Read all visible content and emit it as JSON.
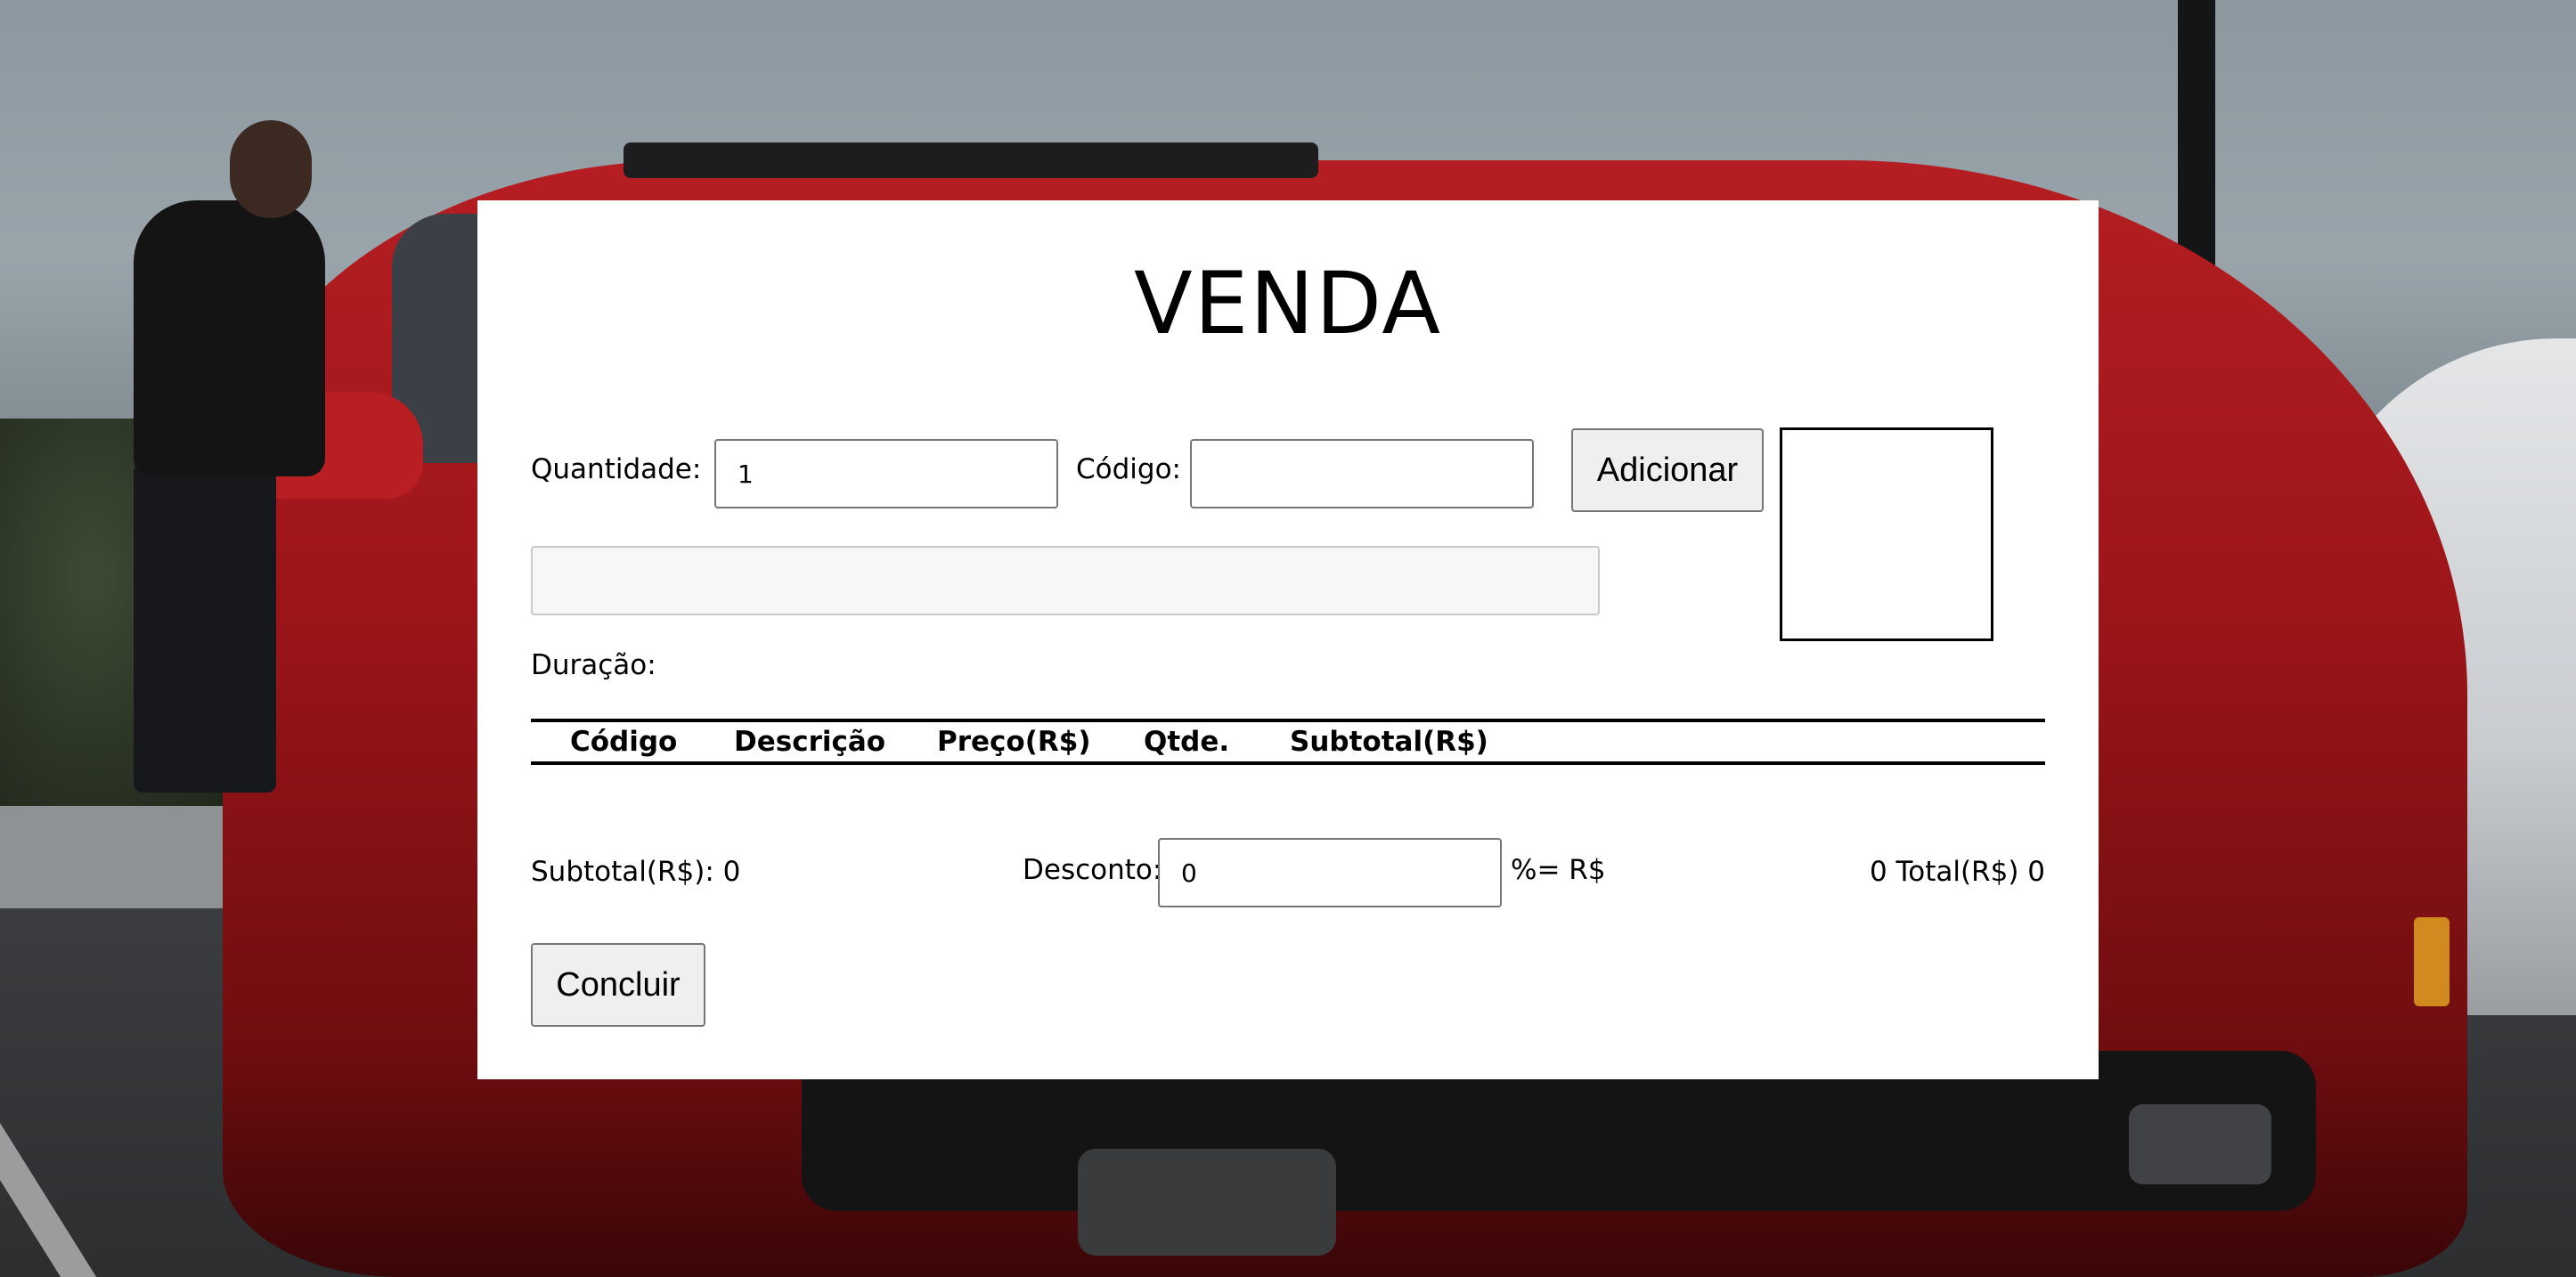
{
  "page": {
    "title": "VENDA"
  },
  "form": {
    "quantidade_label": "Quantidade:",
    "quantidade_value": "1",
    "codigo_label": "Código:",
    "codigo_value": "",
    "adicionar_label": "Adicionar",
    "descricao_value": "",
    "duracao_label": "Duração:"
  },
  "table": {
    "columns": [
      "Código",
      "Descrição",
      "Preço(R$)",
      "Qtde.",
      "Subtotal(R$)"
    ],
    "rows": []
  },
  "summary": {
    "subtotal_text": "Subtotal(R$): 0",
    "desconto_label": "Desconto:",
    "desconto_value": "0",
    "desconto_suffix": "%= R$",
    "total_text": "0 Total(R$) 0"
  },
  "actions": {
    "concluir_label": "Concluir"
  },
  "colors": {
    "panel": "#ffffff",
    "button_bg": "#efefef",
    "input_border": "#767676",
    "disabled_input_bg": "#f7f7f7"
  },
  "icons": {
    "background": "background-photo-red-sports-car",
    "product_image": "product-image-placeholder"
  }
}
